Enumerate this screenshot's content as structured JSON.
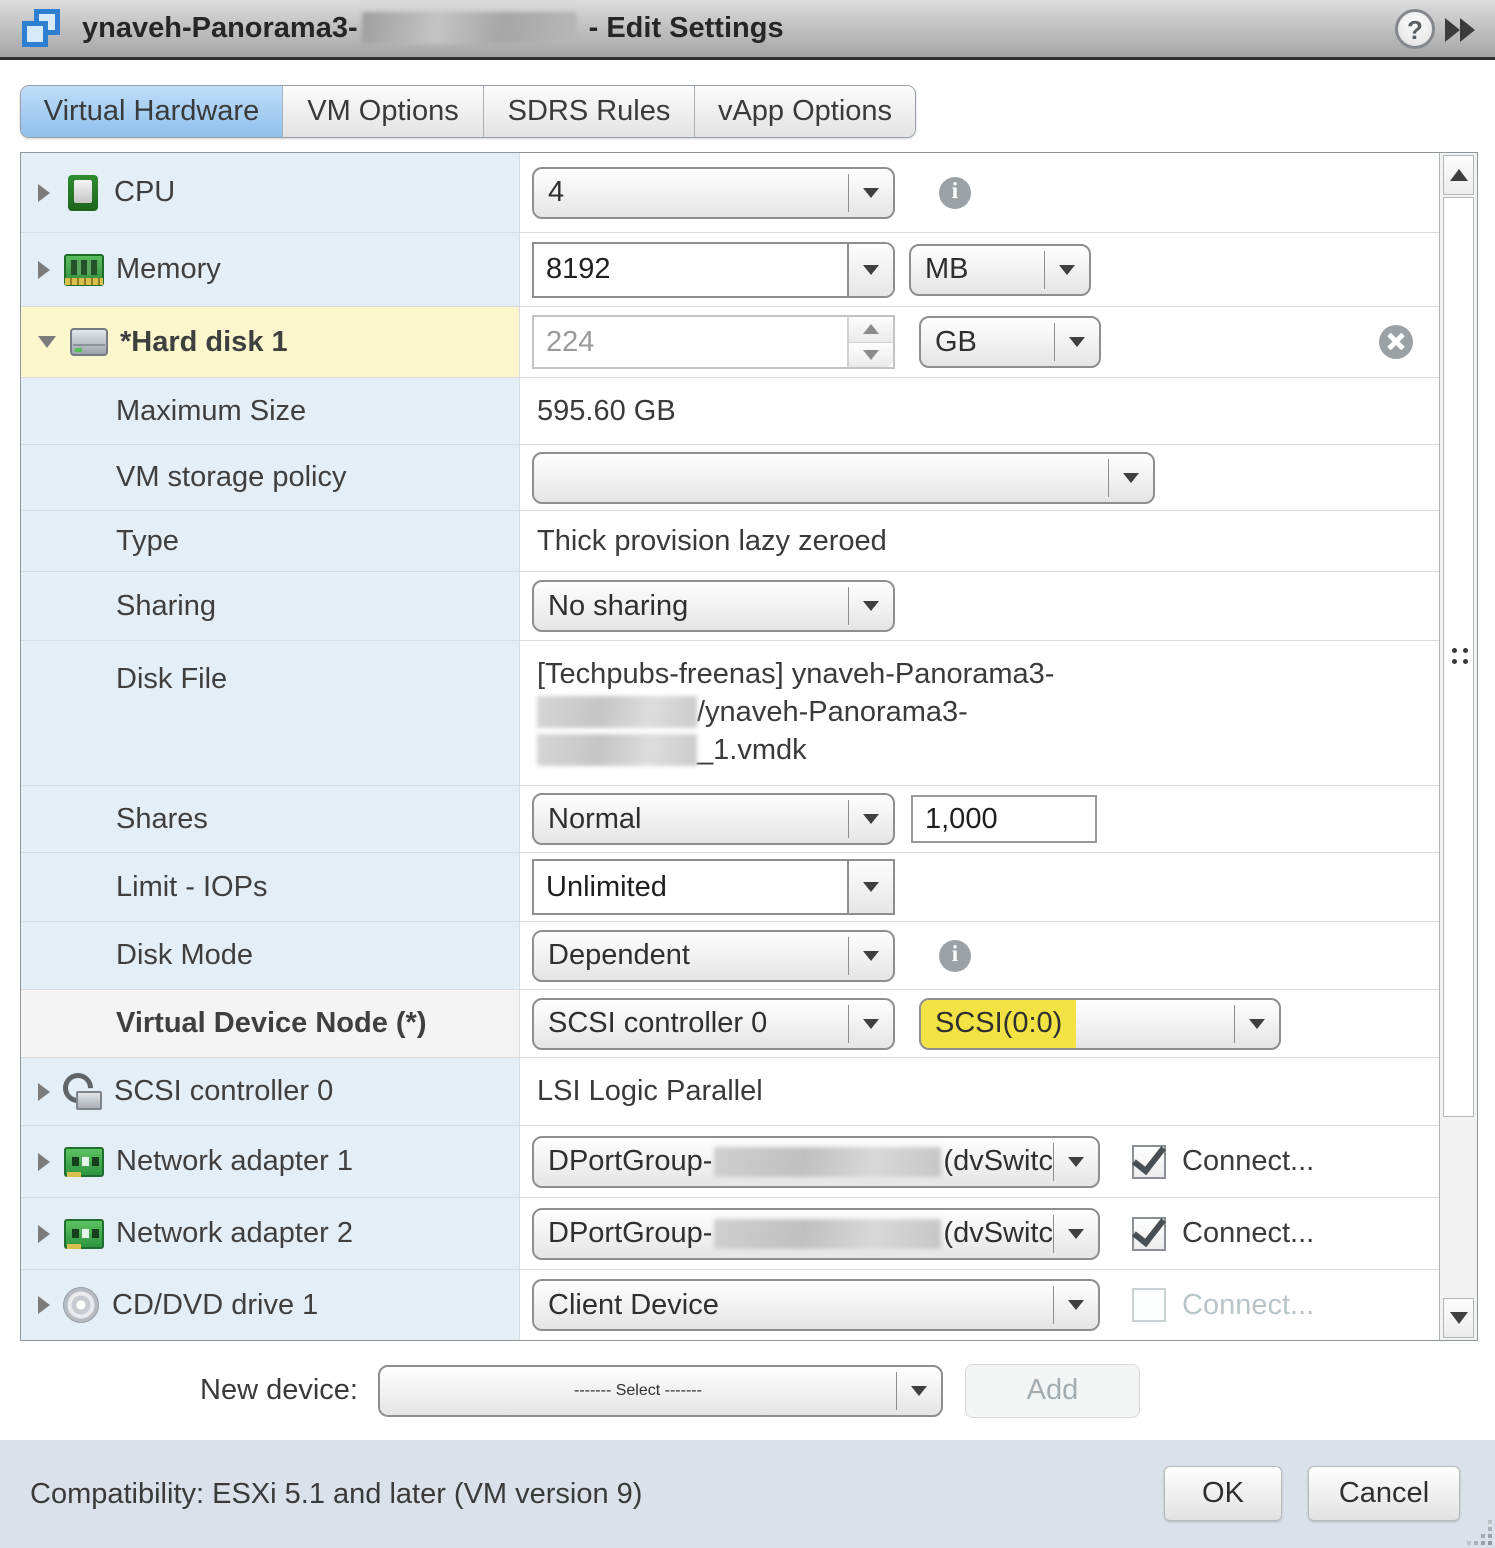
{
  "window": {
    "title_prefix": "ynaveh-Panorama3-",
    "title_suffix": "- Edit Settings"
  },
  "tabs": [
    {
      "label": "Virtual Hardware",
      "selected": true
    },
    {
      "label": "VM Options",
      "selected": false
    },
    {
      "label": "SDRS Rules",
      "selected": false
    },
    {
      "label": "vApp Options",
      "selected": false
    }
  ],
  "rows": {
    "cpu": {
      "label": "CPU",
      "value": "4"
    },
    "memory": {
      "label": "Memory",
      "value": "8192",
      "unit": "MB"
    },
    "hard_disk": {
      "label": "*Hard disk 1",
      "value": "224",
      "unit": "GB"
    },
    "maximum_size": {
      "label": "Maximum Size",
      "value": "595.60 GB"
    },
    "vm_storage_policy": {
      "label": "VM storage policy",
      "value": ""
    },
    "type": {
      "label": "Type",
      "value": "Thick provision lazy zeroed"
    },
    "sharing": {
      "label": "Sharing",
      "value": "No sharing"
    },
    "disk_file": {
      "label": "Disk File",
      "line1": "[Techpubs-freenas] ynaveh-Panorama3-",
      "line2": "/ynaveh-Panorama3-",
      "line3": "_1.vmdk"
    },
    "shares": {
      "label": "Shares",
      "value": "Normal",
      "amount": "1,000"
    },
    "limit_iops": {
      "label": "Limit - IOPs",
      "value": "Unlimited"
    },
    "disk_mode": {
      "label": "Disk Mode",
      "value": "Dependent"
    },
    "virtual_device_node": {
      "label": "Virtual Device Node (*)",
      "controller": "SCSI controller 0",
      "node": "SCSI(0:0)"
    },
    "scsi_controller": {
      "label": "SCSI controller 0",
      "value": "LSI Logic Parallel"
    },
    "network_adapter_1": {
      "label": "Network adapter 1",
      "value_prefix": "DPortGroup-",
      "value_suffix": "(dvSwitc",
      "connect_label": "Connect...",
      "connected": true
    },
    "network_adapter_2": {
      "label": "Network adapter 2",
      "value_prefix": "DPortGroup-",
      "value_suffix": "(dvSwitc",
      "connect_label": "Connect...",
      "connected": true
    },
    "cd_dvd": {
      "label": "CD/DVD drive 1",
      "value": "Client Device",
      "connect_label": "Connect...",
      "connected": false
    }
  },
  "new_device": {
    "label": "New device:",
    "value": "------- Select -------",
    "add_label": "Add"
  },
  "footer": {
    "compatibility": "Compatibility: ESXi 5.1 and later (VM version 9)",
    "ok_label": "OK",
    "cancel_label": "Cancel"
  },
  "colors": {
    "highlight_yellow": "#f2e244",
    "modified_row_yellow": "#fcf6cd",
    "label_column_blue": "#e4eef7",
    "selected_tab_blue": "#8ec0ec",
    "footer_bg": "#dbe1ea"
  }
}
